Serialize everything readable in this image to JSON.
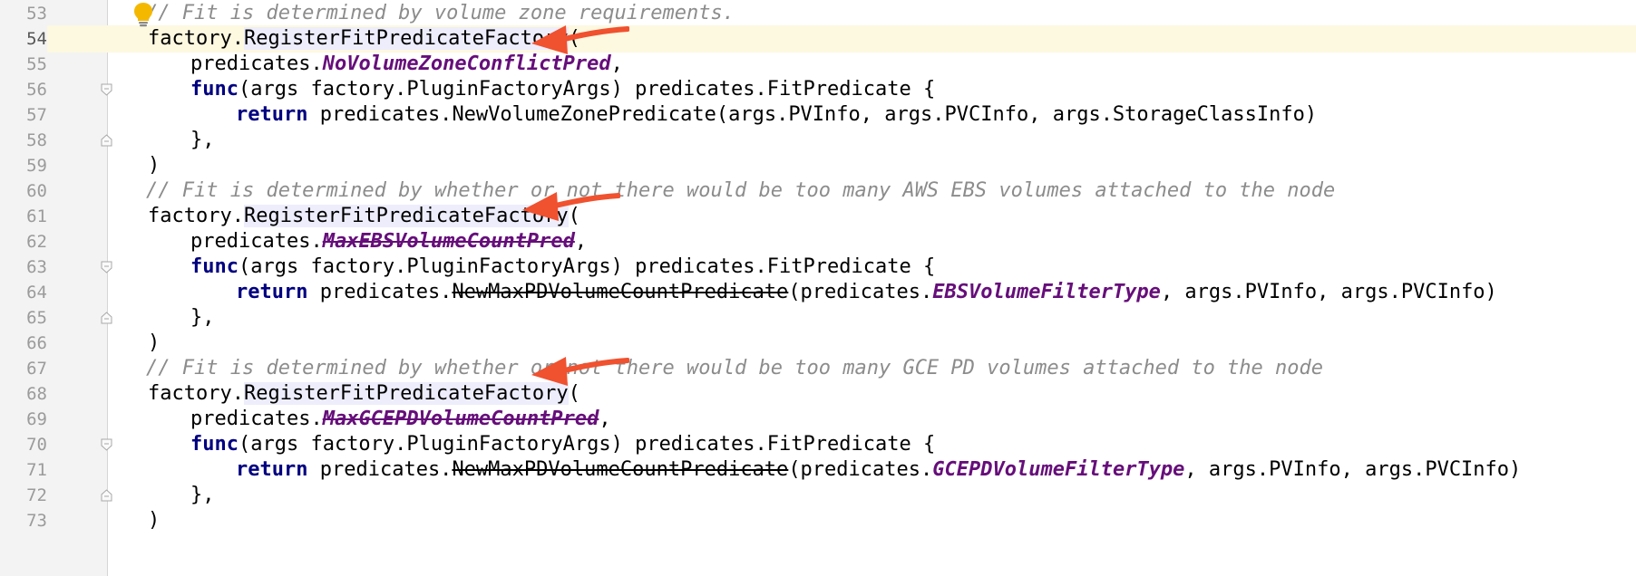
{
  "editor": {
    "colors": {
      "comment": "#8c8c8c",
      "keyword": "#000080",
      "constant": "#660e7a",
      "current_line": "#fdf8e0",
      "arrow": "#f0512f",
      "bulb": "#f5b800"
    },
    "lines": [
      {
        "n": "53"
      },
      {
        "n": "54"
      },
      {
        "n": "55"
      },
      {
        "n": "56"
      },
      {
        "n": "57"
      },
      {
        "n": "58"
      },
      {
        "n": "59"
      },
      {
        "n": "60"
      },
      {
        "n": "61"
      },
      {
        "n": "62"
      },
      {
        "n": "63"
      },
      {
        "n": "64"
      },
      {
        "n": "65"
      },
      {
        "n": "66"
      },
      {
        "n": "67"
      },
      {
        "n": "68"
      },
      {
        "n": "69"
      },
      {
        "n": "70"
      },
      {
        "n": "71"
      },
      {
        "n": "72"
      },
      {
        "n": "73"
      }
    ],
    "text": {
      "c1": "// Fit is determined by volume zone requirements.",
      "c2": "// Fit is determined by whether or not there would be too many AWS EBS volumes attached to the node",
      "c3": "// Fit is determined by whether or not there would be too many GCE PD volumes attached to the node",
      "factory": "factory.",
      "register": "RegisterFitPredicateFactory",
      "paren_open": "(",
      "paren_close": ")",
      "predicates": "predicates.",
      "comma": ",",
      "func": "func",
      "func_sig": "(args factory.PluginFactoryArgs) predicates.FitPredicate {",
      "return": "return",
      "close_brace": "},",
      "pred1": "NoVolumeZoneConflictPred",
      "pred2": "MaxEBSVolumeCountPred",
      "pred3": "MaxGCEPDVolumeCountPred",
      "ret1_call": "NewVolumeZonePredicate",
      "ret1_args": "(args.PVInfo, args.PVCInfo, args.StorageClassInfo)",
      "ret_call2": "NewMaxPDVolumeCountPredicate",
      "ret_mid": "(predicates.",
      "filter_ebs": "EBSVolumeFilterType",
      "filter_gce": "GCEPDVolumeFilterType",
      "ret_tail": ", args.PVInfo, args.PVCInfo)"
    }
  }
}
